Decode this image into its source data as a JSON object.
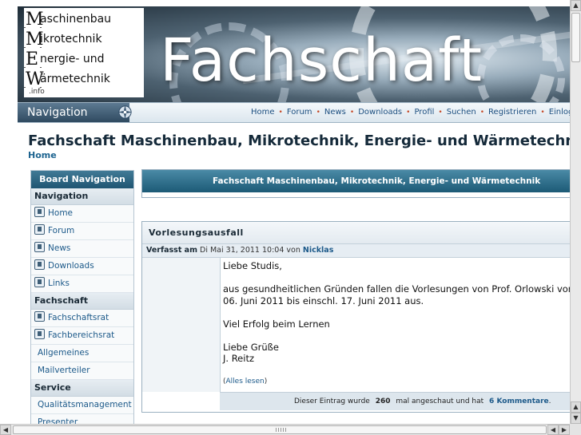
{
  "banner": {
    "title": "Fachschaft",
    "logo": {
      "rows": [
        {
          "letter": "M",
          "rest": "aschinenbau"
        },
        {
          "letter": "M",
          "rest": "ikrotechnik"
        },
        {
          "letter": "E",
          "rest": "nergie- und"
        },
        {
          "letter": "W",
          "rest": "ärmetechnik"
        }
      ],
      "suffix": ".info"
    }
  },
  "navbar": {
    "label": "Navigation",
    "items": [
      "Home",
      "Forum",
      "News",
      "Downloads",
      "Profil",
      "Suchen",
      "Registrieren",
      "Einloggen"
    ]
  },
  "page": {
    "heading": "Fachschaft Maschinenbau, Mikrotechnik, Energie- und Wärmetechnik",
    "home_link": "Home"
  },
  "sidebar": {
    "header": "Board Navigation",
    "sections": [
      {
        "title": "Navigation",
        "items": [
          {
            "label": "Home",
            "icon": "home-icon"
          },
          {
            "label": "Forum",
            "icon": "forum-icon"
          },
          {
            "label": "News",
            "icon": "news-icon"
          },
          {
            "label": "Downloads",
            "icon": "downloads-icon"
          },
          {
            "label": "Links",
            "icon": "links-icon"
          }
        ]
      },
      {
        "title": "Fachschaft",
        "items": [
          {
            "label": "Fachschaftsrat",
            "icon": "info-icon"
          },
          {
            "label": "Fachbereichsrat",
            "icon": "info-icon"
          },
          {
            "label": "Allgemeines",
            "icon": ""
          },
          {
            "label": "Mailverteiler",
            "icon": ""
          }
        ]
      },
      {
        "title": "Service",
        "items": [
          {
            "label": "Qualitätsmanagement",
            "icon": ""
          },
          {
            "label": "Presenter",
            "icon": ""
          }
        ]
      }
    ]
  },
  "main": {
    "box_title": "Fachschaft Maschinenbau, Mikrotechnik, Energie- und Wärmetechnik"
  },
  "post": {
    "title": "Vorlesungsausfall",
    "meta_label": "Verfasst am",
    "meta_date": "Di Mai 31, 2011 10:04 von",
    "author": "Nicklas",
    "body": {
      "greeting": "Liebe Studis,",
      "line1": "aus gesundheitlichen Gründen fallen die Vorlesungen von Prof. Orlowski vom",
      "line2": "06. Juni 2011 bis einschl. 17. Juni 2011 aus.",
      "wish": "Viel Erfolg beim Lernen",
      "closing1": "Liebe Grüße",
      "closing2": "J. Reitz"
    },
    "more_open": "(",
    "more_link": "Alles lesen",
    "more_close": ")",
    "footer_prefix": "Dieser Eintrag wurde",
    "views": "260",
    "footer_mid": "mal angeschaut und hat",
    "comments": "6 Kommentare",
    "footer_end": "."
  }
}
